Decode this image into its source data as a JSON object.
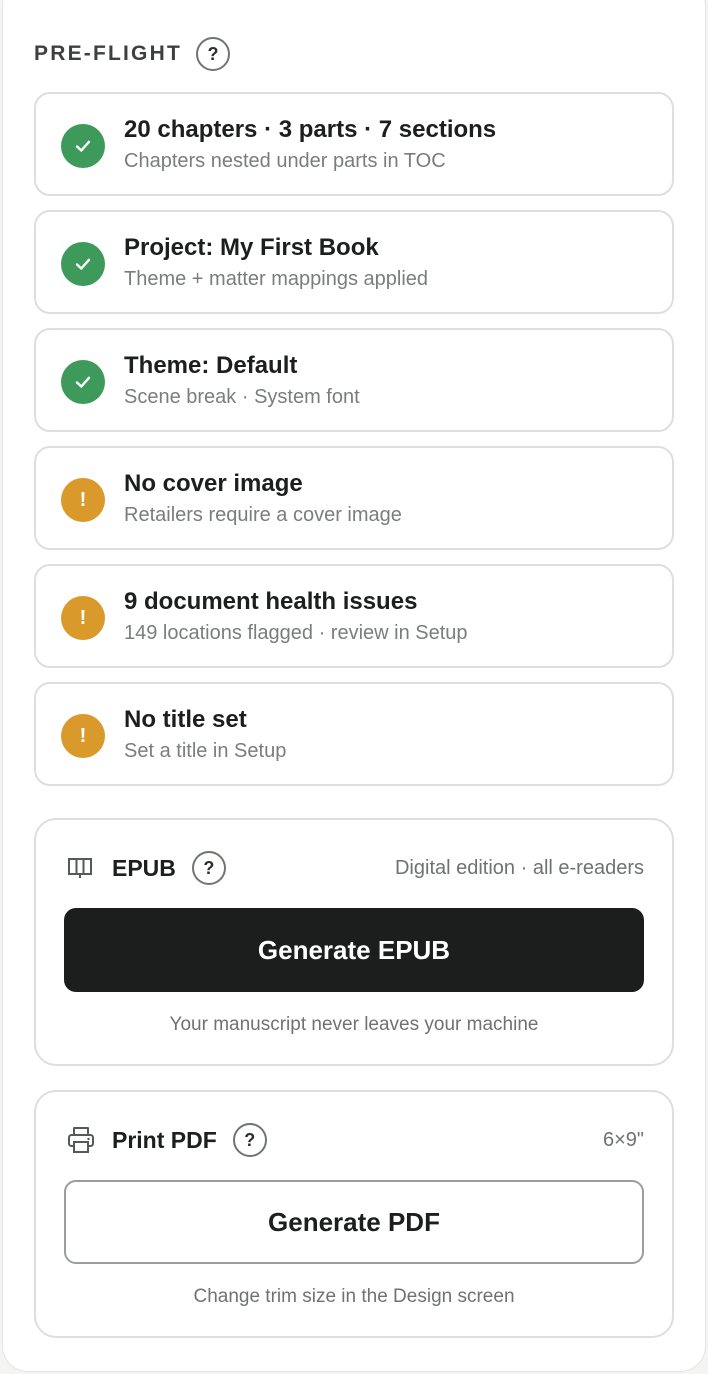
{
  "preflight": {
    "title": "PRE-FLIGHT",
    "help_label": "?",
    "checks": [
      {
        "status": "ok",
        "title": "20 chapters · 3 parts · 7 sections",
        "subtitle": "Chapters nested under parts in TOC"
      },
      {
        "status": "ok",
        "title": "Project: My First Book",
        "subtitle": "Theme + matter mappings applied"
      },
      {
        "status": "ok",
        "title": "Theme: Default",
        "subtitle": "Scene break · System font"
      },
      {
        "status": "warning",
        "title": "No cover image",
        "subtitle": "Retailers require a cover image",
        "icon_text": "!"
      },
      {
        "status": "warning",
        "title": "9 document health issues",
        "subtitle": "149 locations flagged · review in Setup",
        "icon_text": "!"
      },
      {
        "status": "warning",
        "title": "No title set",
        "subtitle": "Set a title in Setup",
        "icon_text": "!"
      }
    ]
  },
  "epub": {
    "icon": "book-icon",
    "name": "EPUB",
    "help_label": "?",
    "meta": "Digital edition · all e-readers",
    "button_label": "Generate EPUB",
    "footnote": "Your manuscript never leaves your machine"
  },
  "pdf": {
    "icon": "printer-icon",
    "name": "Print PDF",
    "help_label": "?",
    "meta": "6×9\"",
    "button_label": "Generate PDF",
    "footnote": "Change trim size in the Design screen"
  },
  "colors": {
    "success": "#3e9a5b",
    "warning": "#d99a2b",
    "primary_button": "#1b1e1c"
  }
}
